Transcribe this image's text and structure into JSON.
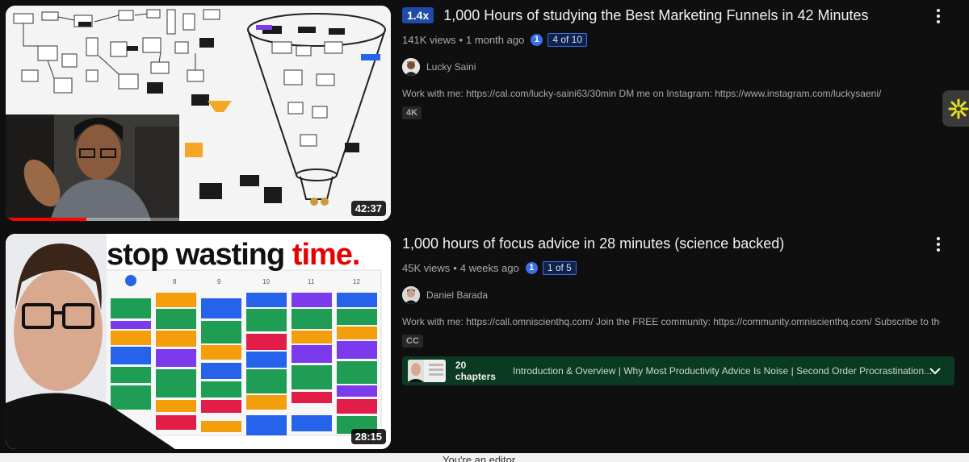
{
  "results": [
    {
      "speed_badge": "1.4x",
      "title": "1,000 Hours of studying the Best Marketing Funnels in 42 Minutes",
      "views": "141K views",
      "age": "1 month ago",
      "part_number": "1",
      "part_label": "4 of 10",
      "channel": "Lucky Saini",
      "description": "Work with me: https://cal.com/lucky-saini63/30min DM me on Instagram: https://www.instagram.com/luckysaeni/",
      "tag": "4K",
      "duration": "42:37",
      "watch_progress": 0.21
    },
    {
      "title": "1,000 hours of focus advice in 28 minutes (science backed)",
      "views": "45K views",
      "age": "4 weeks ago",
      "part_number": "1",
      "part_label": "1 of 5",
      "channel": "Daniel Barada",
      "description": "Work with me: https://call.omniscienthq.com/ Join the FREE community: https://community.omniscienthq.com/ Subscribe to the ...",
      "tag": "CC",
      "duration": "28:15",
      "thumb_headline_a": "stop wasting",
      "thumb_headline_b": "time.",
      "chapters_count": "20 chapters",
      "chapters_list": "Introduction & Overview | Why Most Productivity Advice Is Noise | Second Order Procrastination..."
    }
  ],
  "bottom_bar_text": "You're an editor",
  "colors": {
    "accent_blue": "#3a6ee8",
    "progress_red": "#ff0000",
    "chapters_bg": "#0a3a22"
  }
}
